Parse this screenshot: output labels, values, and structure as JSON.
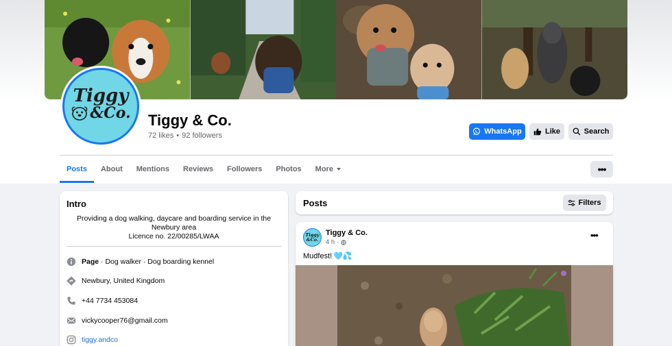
{
  "page": {
    "name": "Tiggy & Co.",
    "likes": "72 likes",
    "separator": "•",
    "followers": "92 followers",
    "logo_line1": "Tiggy",
    "logo_line2": "&Co."
  },
  "actions": {
    "whatsapp_label": "WhatsApp",
    "like_label": "Like",
    "search_label": "Search",
    "more_label": "•••"
  },
  "tabs": [
    {
      "label": "Posts",
      "active": true
    },
    {
      "label": "About"
    },
    {
      "label": "Mentions"
    },
    {
      "label": "Reviews"
    },
    {
      "label": "Followers"
    },
    {
      "label": "Photos"
    },
    {
      "label": "More"
    }
  ],
  "intro": {
    "title": "Intro",
    "bio_line1": "Providing a dog walking, daycare and boarding service in the",
    "bio_line2": "Newbury area",
    "bio_line3": "Licence no. 22/00285/LWAA",
    "category_prefix": "Page",
    "category_rest": " · Dog walker · Dog boarding kennel",
    "location": "Newbury, United Kingdom",
    "phone": "+44 7734 453084",
    "email": "vickycooper76@gmail.com",
    "instagram": "tiggy.andco"
  },
  "posts": {
    "title": "Posts",
    "filters_label": "Filters",
    "post": {
      "author": "Tiggy & Co.",
      "avatar_text": "Tiggy &Co.",
      "time": "4 h",
      "meta_separator": "·",
      "text": "Mudfest!",
      "emoji": "🩵💦",
      "options": "•••"
    }
  },
  "colors": {
    "accent": "#1877f2",
    "logo_bg": "#71d6e6",
    "page_bg": "#f0f2f5"
  },
  "icons": [
    "whatsapp-icon",
    "thumbs-up-icon",
    "search-icon",
    "info-icon",
    "location-icon",
    "phone-icon",
    "mail-icon",
    "instagram-icon",
    "filter-icon",
    "globe-icon"
  ]
}
